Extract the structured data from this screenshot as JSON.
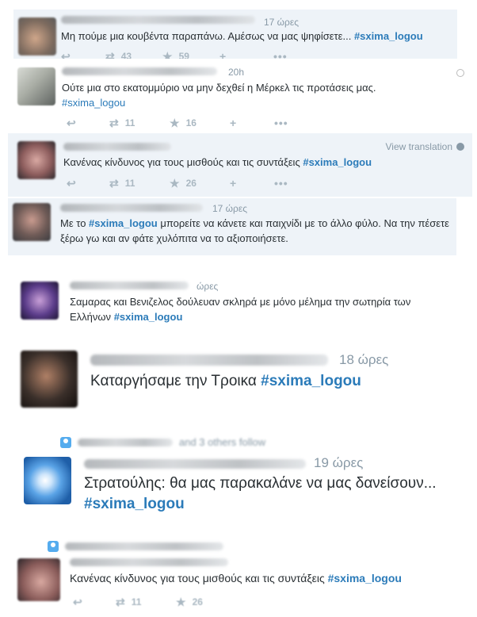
{
  "hashtag": "#sxima_logou",
  "tweets": [
    {
      "time": "17 ώρες",
      "text": "Μη πούμε μια κουβέντα παραπάνω. Αμέσως να μας ψηφίσετε...",
      "retweets": "43",
      "likes": "59"
    },
    {
      "time": "20h",
      "text": "Ούτε μια στο εκατομμύριο να μην δεχθεί η Μέρκελ τις προτάσεις μας.",
      "retweets": "11",
      "likes": "16"
    },
    {
      "view_translation": "View translation",
      "text": "Κανένας κίνδυνος για τους μισθούς και τις συντάξεις",
      "retweets": "11",
      "likes": "26"
    },
    {
      "time": "17 ώρες",
      "text_a": "Με το",
      "text_b": "μπορείτε να κάνετε και παιχνίδι με το άλλο φύλο. Να την πέσετε ξέρω γω και αν φάτε χυλόπιτα να το αξιοποιήσετε."
    },
    {
      "time": "ώρες",
      "text": "Σαμαρας και Βενιζελος δούλευαν σκληρά με μόνο μέλημα την σωτηρία των Ελλήνων"
    },
    {
      "time": "18 ώρες",
      "text": "Καταργήσαμε την Τροικα"
    },
    {
      "follow_text": "and 3 others follow",
      "time": "19 ώρες",
      "text": "Στρατούλης: θα μας παρακαλάνε να μας δανείσουν..."
    },
    {
      "text": "Κανένας κίνδυνος για τους μισθούς και τις συντάξεις",
      "retweets": "11",
      "likes": "26"
    }
  ],
  "colors": {
    "link": "#2b7bb9",
    "highlight_bg": "#eef3f8",
    "muted": "#8899a6",
    "icon": "#aab8c2"
  },
  "icons": [
    "reply-icon",
    "retweet-icon",
    "like-star-icon",
    "follow-icon",
    "more-icon",
    "globe-icon",
    "person-icon"
  ]
}
